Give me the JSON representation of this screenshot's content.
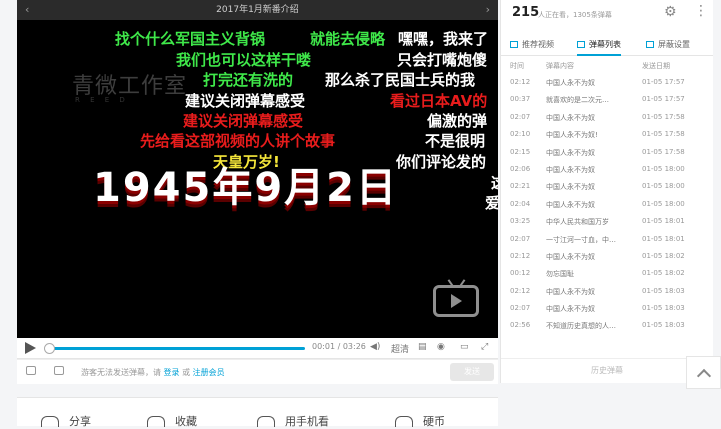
{
  "player": {
    "title": "2017年1月新番介绍",
    "nav_prev": "‹",
    "nav_next": "›",
    "watermark": "青微工作室",
    "watermark_sub": "R   E   E   D",
    "big_text": "1945年9月2日",
    "danmaku": [
      {
        "text": "找个什么军国主义背锅",
        "color": "#3fe84a"
      },
      {
        "text": "就能去侵略",
        "color": "#3fe84a"
      },
      {
        "text": "嘿嘿，我来了",
        "color": "#ffffff"
      },
      {
        "text": "我们也可以这样干喽",
        "color": "#3fe84a"
      },
      {
        "text": "只会打嘴炮傻",
        "color": "#ffffff"
      },
      {
        "text": "打完还有洗的",
        "color": "#3fe84a"
      },
      {
        "text": "那么杀了民国士兵的我",
        "color": "#ffffff"
      },
      {
        "text": "建议关闭弹幕感受",
        "color": "#ffffff"
      },
      {
        "text": "看过日本AV的",
        "color": "#e81c1c"
      },
      {
        "text": "建议关闭弹幕感受",
        "color": "#e81c1c"
      },
      {
        "text": "偏激的弹",
        "color": "#ffffff"
      },
      {
        "text": "先给看这部视频的人讲个故事",
        "color": "#e81c1c"
      },
      {
        "text": "不是很明",
        "color": "#ffffff"
      },
      {
        "text": "天皇万岁!",
        "color": "#f5e63a"
      },
      {
        "text": "你们评论发的",
        "color": "#ffffff"
      },
      {
        "text": "这",
        "color": "#ffffff"
      },
      {
        "text": "爱",
        "color": "#ffffff"
      }
    ]
  },
  "controls": {
    "time": "00:01 / 03:26",
    "hd_label": "超清"
  },
  "danmaku_bar": {
    "hint_prefix": "游客无法发送弹幕，请",
    "login": "登录",
    "or": "或",
    "register": "注册会员",
    "send": "发送"
  },
  "sidebar": {
    "viewer_count": "215",
    "viewer_sub": "人正在看，1305条弹幕",
    "tabs": [
      {
        "label": "推荐视频"
      },
      {
        "label": "弹幕列表"
      },
      {
        "label": "屏蔽设置"
      }
    ],
    "columns": [
      "时间",
      "弹幕内容",
      "发送日期"
    ],
    "rows": [
      [
        "02:12",
        "中国人永不为奴",
        "01-05 17:57"
      ],
      [
        "00:37",
        "就喜欢的是二次元…",
        "01-05 17:57"
      ],
      [
        "02:07",
        "中国人永不为奴",
        "01-05 17:58"
      ],
      [
        "02:10",
        "中国人永不为奴!",
        "01-05 17:58"
      ],
      [
        "02:15",
        "中国人永不为奴",
        "01-05 17:58"
      ],
      [
        "02:06",
        "中国人永不为奴",
        "01-05 18:00"
      ],
      [
        "02:21",
        "中国人永不为奴",
        "01-05 18:00"
      ],
      [
        "02:04",
        "中国人永不为奴",
        "01-05 18:00"
      ],
      [
        "03:25",
        "中华人民共和国万岁",
        "01-05 18:01"
      ],
      [
        "02:07",
        "一寸江河一寸血，中…",
        "01-05 18:01"
      ],
      [
        "02:12",
        "中国人永不为奴",
        "01-05 18:02"
      ],
      [
        "00:12",
        "勿忘国耻",
        "01-05 18:02"
      ],
      [
        "02:12",
        "中国人永不为奴",
        "01-05 18:03"
      ],
      [
        "02:07",
        "中国人永不为奴",
        "01-05 18:03"
      ],
      [
        "02:56",
        "不知道历史真想的人…",
        "01-05 18:03"
      ]
    ],
    "history": "历史弹幕"
  },
  "actions": [
    {
      "label": "分享"
    },
    {
      "label": "收藏"
    },
    {
      "label": "用手机看"
    },
    {
      "label": "硬币"
    }
  ]
}
